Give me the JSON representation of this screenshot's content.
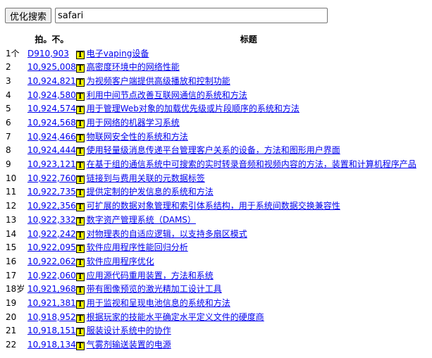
{
  "search": {
    "button_label": "优化搜索",
    "query_value": "safari"
  },
  "table": {
    "headers": {
      "num": "",
      "patent": "拍。不。",
      "title": "标题"
    },
    "rows": [
      {
        "num": "1个",
        "patent": "D910,903",
        "title": "电子vaping设备"
      },
      {
        "num": "2",
        "patent": "10,925,008",
        "title": "高密度环境中的网络性能"
      },
      {
        "num": "3",
        "patent": "10,924,821",
        "title": "为视频客户端提供高级播放和控制功能"
      },
      {
        "num": "4",
        "patent": "10,924,580",
        "title": "利用中间节点改善互联网通信的系统和方法"
      },
      {
        "num": "5",
        "patent": "10,924,574",
        "title": "用于管理Web对象的加载优先级或片段顺序的系统和方法"
      },
      {
        "num": "6",
        "patent": "10,924,568",
        "title": "用于网络的机器学习系统"
      },
      {
        "num": "7",
        "patent": "10,924,466",
        "title": "物联网安全性的系统和方法"
      },
      {
        "num": "8",
        "patent": "10,924,444",
        "title": "使用轻量级消息传递平台管理客户关系的设备，方法和图形用户界面"
      },
      {
        "num": "9",
        "patent": "10,923,121",
        "title": "在基于组的通信系统中可搜索的实时转录音频和视频内容的方法，装置和计算机程序产品"
      },
      {
        "num": "10",
        "patent": "10,922,760",
        "title": "链接到与费用关联的元数据标签"
      },
      {
        "num": "11",
        "patent": "10,922,735",
        "title": "提供定制的护发信息的系统和方法"
      },
      {
        "num": "12",
        "patent": "10,922,356",
        "title": "可扩展的数据对象管理和索引体系结构，用于系统间数据交换兼容性"
      },
      {
        "num": "13",
        "patent": "10,922,332",
        "title": "数字资产管理系统（DAMS）"
      },
      {
        "num": "14",
        "patent": "10,922,242",
        "title": "对物理表的自适应逻辑，以支持多扇区模式"
      },
      {
        "num": "15",
        "patent": "10,922,095",
        "title": "软件应用程序性能回归分析"
      },
      {
        "num": "16",
        "patent": "10,922,062",
        "title": "软件应用程序优化"
      },
      {
        "num": "17",
        "patent": "10,922,060",
        "title": "应用源代码重用装置，方法和系统"
      },
      {
        "num": "18岁",
        "patent": "10,921,968",
        "title": "带有图像预览的激光精加工设计工具"
      },
      {
        "num": "19",
        "patent": "10,921,381",
        "title": "用于监视和呈现电池信息的系统和方法"
      },
      {
        "num": "20",
        "patent": "10,918,952",
        "title": "根据玩家的技能水平确定水平定义文件的硬度商"
      },
      {
        "num": "21",
        "patent": "10,918,151",
        "title": "服装设计系统中的协作"
      },
      {
        "num": "22",
        "patent": "10,918,134",
        "title": "气雾剂输送装置的电源"
      }
    ]
  },
  "icon": {
    "glyph": "T",
    "color": "#ffff00"
  }
}
